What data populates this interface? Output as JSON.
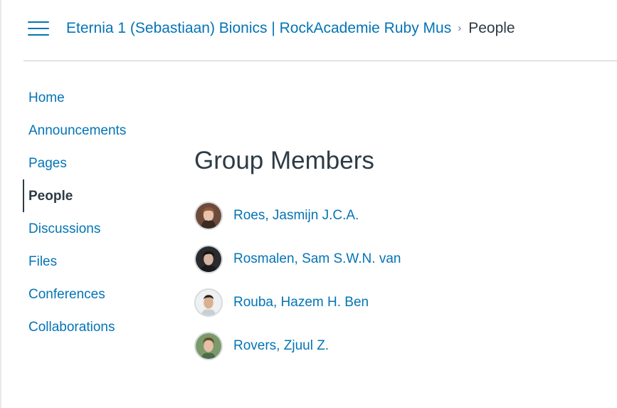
{
  "header": {
    "course_link": "Eternia 1 (Sebastiaan) Bionics | RockAcademie Ruby Mus",
    "separator": "›",
    "current": "People"
  },
  "sidebar": {
    "items": [
      {
        "label": "Home"
      },
      {
        "label": "Announcements"
      },
      {
        "label": "Pages"
      },
      {
        "label": "People",
        "active": true
      },
      {
        "label": "Discussions"
      },
      {
        "label": "Files"
      },
      {
        "label": "Conferences"
      },
      {
        "label": "Collaborations"
      }
    ]
  },
  "main": {
    "title": "Group Members",
    "members": [
      {
        "name": "Roes, Jasmijn J.C.A.",
        "avatar_icon": "user-photo-icon"
      },
      {
        "name": "Rosmalen, Sam S.W.N. van",
        "avatar_icon": "user-photo-icon"
      },
      {
        "name": "Rouba, Hazem H. Ben",
        "avatar_icon": "user-photo-icon"
      },
      {
        "name": "Rovers, Zjuul Z.",
        "avatar_icon": "user-photo-icon"
      }
    ]
  },
  "colors": {
    "link": "#0374b5",
    "text": "#2d3b45",
    "divider": "#c7cdd1"
  }
}
